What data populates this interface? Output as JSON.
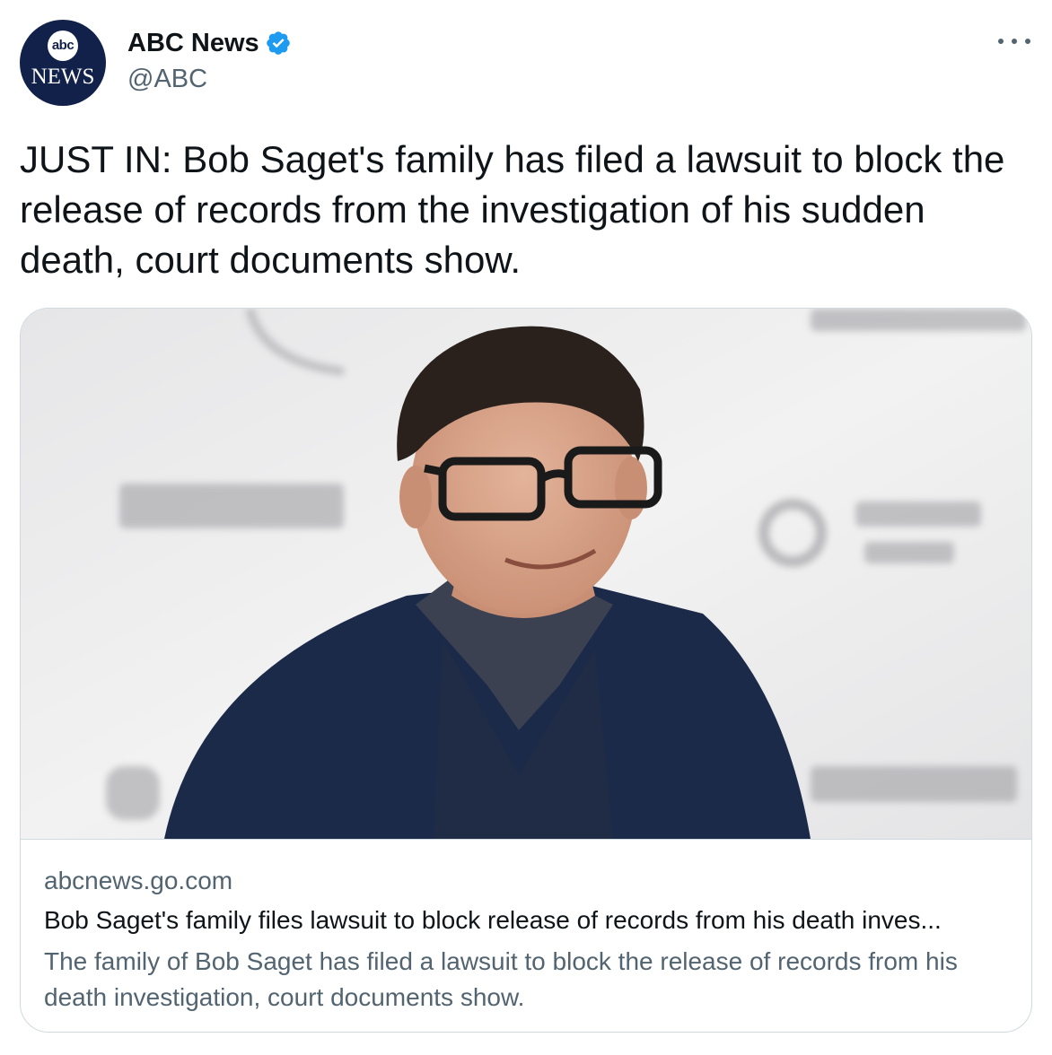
{
  "header": {
    "avatar_abc": "abc",
    "avatar_news": "NEWS",
    "display_name": "ABC News",
    "handle": "@ABC",
    "verified_icon": "verified-badge-icon",
    "more_icon": "more-dots-icon"
  },
  "tweet": {
    "text": "JUST IN: Bob Saget's family has filed a lawsuit to block the release of records from the investigation of his sudden death, court documents show."
  },
  "card": {
    "domain": "abcnews.go.com",
    "title": "Bob Saget's family files lawsuit to block release of records from his death inves...",
    "description": "The family of Bob Saget has filed a lawsuit to block the release of records from his death investigation, court documents show."
  },
  "colors": {
    "brand_navy": "#12214a",
    "verified_blue": "#1d9bf0",
    "secondary_text": "#536471",
    "border": "#cfd9de"
  }
}
